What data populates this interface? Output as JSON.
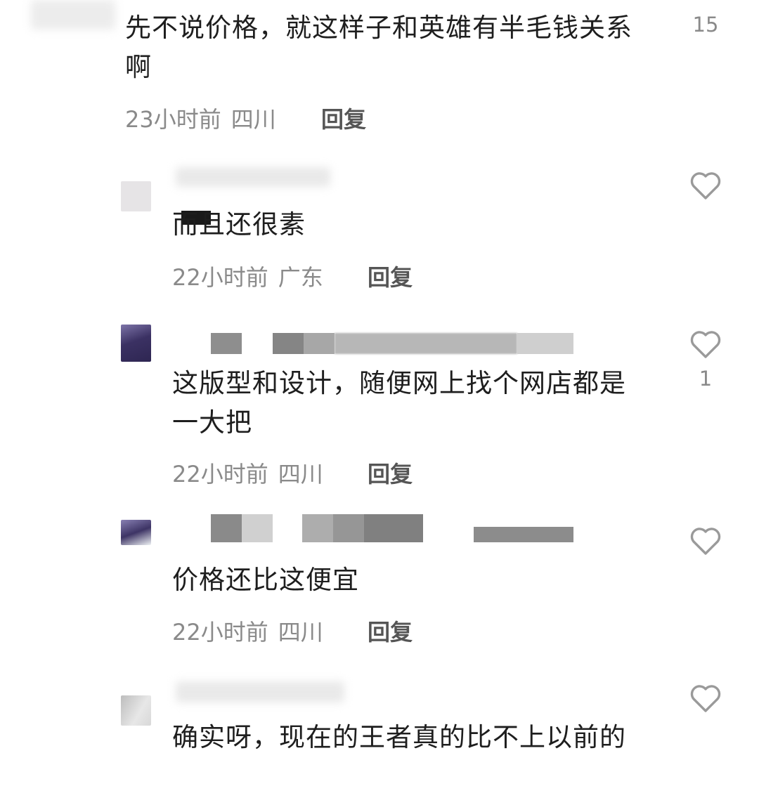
{
  "comments": [
    {
      "text": "先不说价格，就这样子和英雄有半毛钱关系啊",
      "time": "23小时前",
      "location": "四川",
      "reply_label": "回复",
      "likes": "15"
    },
    {
      "text": "而且还很素",
      "time": "22小时前",
      "location": "广东",
      "reply_label": "回复",
      "likes": ""
    },
    {
      "text": "这版型和设计，随便网上找个网店都是一大把",
      "time": "22小时前",
      "location": "四川",
      "reply_label": "回复",
      "likes": "1"
    },
    {
      "text": "价格还比这便宜",
      "time": "22小时前",
      "location": "四川",
      "reply_label": "回复",
      "likes": ""
    },
    {
      "text": "确实呀，现在的王者真的比不上以前的",
      "likes": ""
    }
  ],
  "icons": {
    "like": "heart-outline-icon"
  },
  "colors": {
    "text": "#1e1e1e",
    "meta": "#8a8a8a",
    "reply": "#555555",
    "heart": "#9a9a9a"
  }
}
